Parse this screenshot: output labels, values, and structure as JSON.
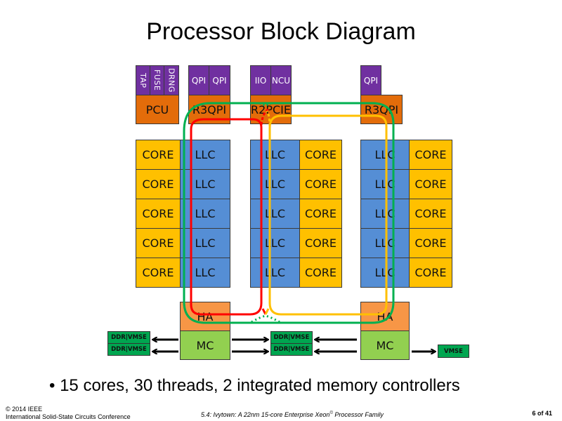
{
  "title": "Processor Block Diagram",
  "top_units": {
    "group1": {
      "small": [
        "TAP",
        "FUSE",
        "DRNG"
      ],
      "main": "PCU"
    },
    "group2": {
      "small": [
        "QPI",
        "QPI"
      ],
      "main": "R3QPI"
    },
    "group3": {
      "small": [
        "IIO",
        "NCU"
      ],
      "main": "R2PCIE"
    },
    "group4": {
      "small": [
        "QPI"
      ],
      "main": "R3QPI"
    }
  },
  "columns": {
    "left": {
      "core_label": "CORE",
      "llc_label": "LLC",
      "rows": 5
    },
    "middle": {
      "core_label": "CORE",
      "llc_label": "LLC",
      "rows": 5
    },
    "right": {
      "core_label": "CORE",
      "llc_label": "LLC",
      "rows": 5
    }
  },
  "labels": {
    "core": "CORE",
    "llc": "LLC",
    "ha": "HA",
    "mc": "MC",
    "ddr": "DDR|VMSE",
    "vmse": "VMSE"
  },
  "rings": [
    {
      "name": "ring-red",
      "color": "#ff0000"
    },
    {
      "name": "ring-yellow",
      "color": "#ffc000"
    },
    {
      "name": "ring-green",
      "color": "#00b050"
    }
  ],
  "colors": {
    "purple": "#7030a0",
    "orange": "#e36c0a",
    "core": "#ffc000",
    "llc": "#558ed5",
    "ha": "#f79646",
    "mc": "#92d050",
    "ddr": "#00a650"
  },
  "bullet": "15 cores, 30 threads, 2 integrated memory controllers",
  "footer": {
    "copyright": "© 2014 IEEE",
    "conference": "International Solid-State Circuits Conference",
    "paper_title": "5.4: Ivytown: A 22nm 15-core Enterprise Xeon",
    "paper_title_sup": "©",
    "paper_title_end": " Processor Family",
    "page": "6 of 41"
  }
}
